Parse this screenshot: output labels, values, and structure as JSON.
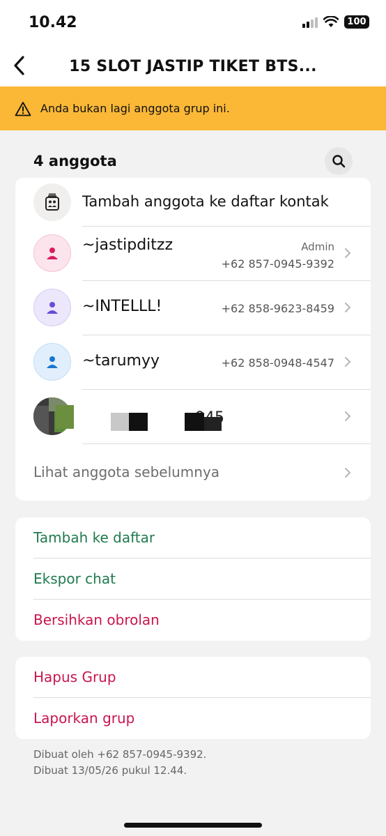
{
  "status_bar": {
    "time": "10.42",
    "battery": "100"
  },
  "nav": {
    "title": "15 SLOT JASTIP TIKET BTS..."
  },
  "banner": {
    "text": "Anda bukan lagi anggota grup ini."
  },
  "members": {
    "count_label": "4 anggota",
    "add_contacts_label": "Tambah anggota ke daftar kontak",
    "list": [
      {
        "name": "~jastipditzz",
        "phone": "+62 857-0945-9392",
        "badge": "Admin",
        "color": "#d81b60",
        "bg": "#fce4ec"
      },
      {
        "name": "~INTELLL!",
        "phone": "+62 858-9623-8459",
        "color": "#6a4bd8",
        "bg": "#ece7fb"
      },
      {
        "name": "~tarumyy",
        "phone": "+62 858-0948-4547",
        "color": "#1976d2",
        "bg": "#e1effc"
      }
    ],
    "redacted_fragment": "945",
    "see_previous_label": "Lihat anggota sebelumnya"
  },
  "actions": {
    "add_to_list": "Tambah ke daftar",
    "export_chat": "Ekspor chat",
    "clear_chat": "Bersihkan obrolan"
  },
  "danger": {
    "delete_group": "Hapus Grup",
    "report_group": "Laporkan grup"
  },
  "footer": {
    "created_by": "Dibuat oleh +62 857-0945-9392.",
    "created_at": "Dibuat 13/05/26 pukul 12.44."
  },
  "colors": {
    "banner": "#fbb837",
    "green": "#1f7a4e",
    "red": "#c8164e"
  }
}
